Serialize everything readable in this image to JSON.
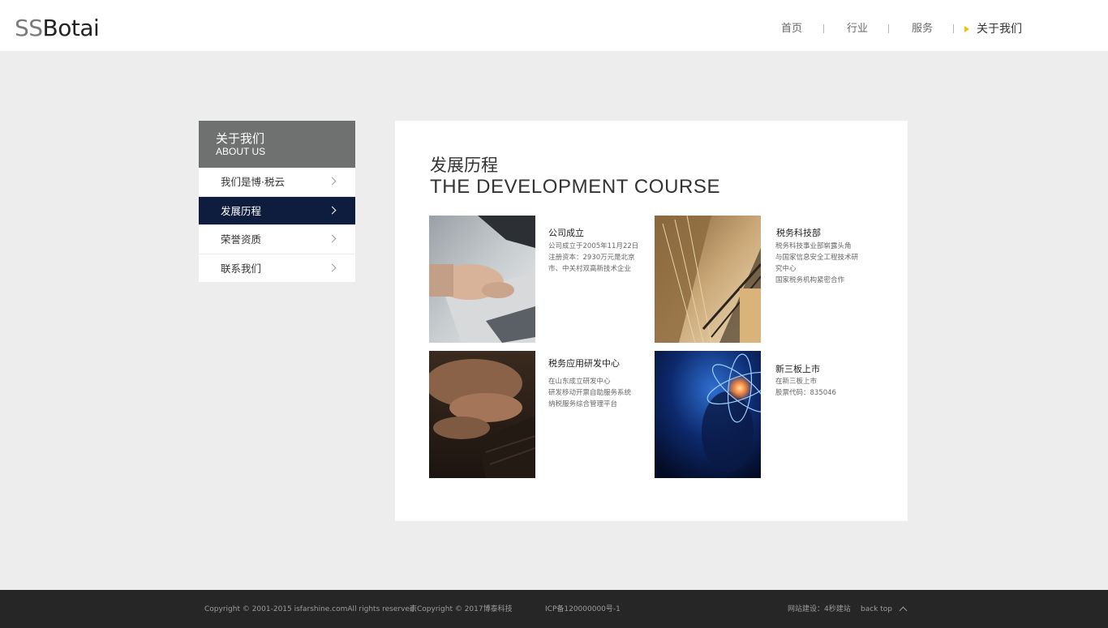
{
  "header": {
    "logo_prefix": "SS",
    "logo_suffix": "Botai",
    "nav": [
      "首页",
      "行业",
      "服务",
      "关于我们"
    ],
    "active_nav": "关于我们"
  },
  "sidebar": {
    "title_cn": "关于我们",
    "title_en": "ABOUT US",
    "items": [
      {
        "label": "我们是博·税云"
      },
      {
        "label": "发展历程"
      },
      {
        "label": "荣誉资质"
      },
      {
        "label": "联系我们"
      }
    ],
    "active_item": "发展历程"
  },
  "main": {
    "title_cn": "发展历程",
    "title_en": "THE DEVELOPMENT COURSE",
    "cards": [
      {
        "title": "公司成立",
        "lines": [
          "公司成立于2005年11月22日",
          "注册资本：2930万元是北京",
          "市、中关村双高新技术企业"
        ],
        "image": "laptop-photo"
      },
      {
        "title": "税务科技部",
        "lines": [
          "税务科技事业部崭露头角",
          "与国家信息安全工程技术研",
          "究中心",
          "国家税务机构紧密合作"
        ],
        "image": "skyscraper-photo"
      },
      {
        "title": "税务应用研发中心",
        "lines": [
          "在山东成立研发中心",
          "研发移动开票自助服务系统",
          "纳税服务综合管理平台"
        ],
        "image": "typing-photo"
      },
      {
        "title": "新三板上市",
        "lines": [
          "在新三板上市",
          "股票代码：835046"
        ],
        "image": "atom-photo"
      }
    ]
  },
  "footer": {
    "copyright": "Copyright  ©  2001-2015  isfarshine.comAll  rights  reserved.",
    "copyright2": "京Copyright © 2017博泰科技",
    "icp": "ICP备120000000号-1",
    "builder": "网站建设：4秒建站",
    "back_top": "back top"
  }
}
